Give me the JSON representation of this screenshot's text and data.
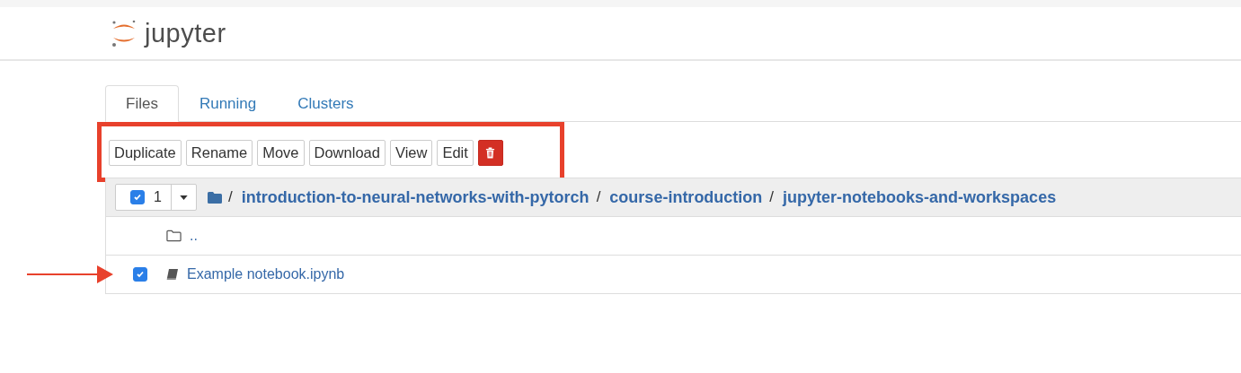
{
  "header": {
    "logo_text": "jupyter"
  },
  "tabs": [
    {
      "label": "Files",
      "selected": true
    },
    {
      "label": "Running",
      "selected": false
    },
    {
      "label": "Clusters",
      "selected": false
    }
  ],
  "toolbar": {
    "highlighted": true,
    "buttons": [
      {
        "label": "Duplicate",
        "kind": "text"
      },
      {
        "label": "Rename",
        "kind": "text"
      },
      {
        "label": "Move",
        "kind": "text"
      },
      {
        "label": "Download",
        "kind": "text"
      },
      {
        "label": "View",
        "kind": "text"
      },
      {
        "label": "Edit",
        "kind": "text"
      },
      {
        "kind": "delete"
      }
    ]
  },
  "selection": {
    "checked": true,
    "count": "1"
  },
  "breadcrumb": [
    "introduction-to-neural-networks-with-pytorch",
    "course-introduction",
    "jupyter-notebooks-and-workspaces"
  ],
  "separator": "/",
  "rows": [
    {
      "kind": "folder",
      "name": "..",
      "checked": false,
      "pointed": false
    },
    {
      "kind": "notebook",
      "name": "Example notebook.ipynb",
      "checked": true,
      "pointed": true
    }
  ]
}
